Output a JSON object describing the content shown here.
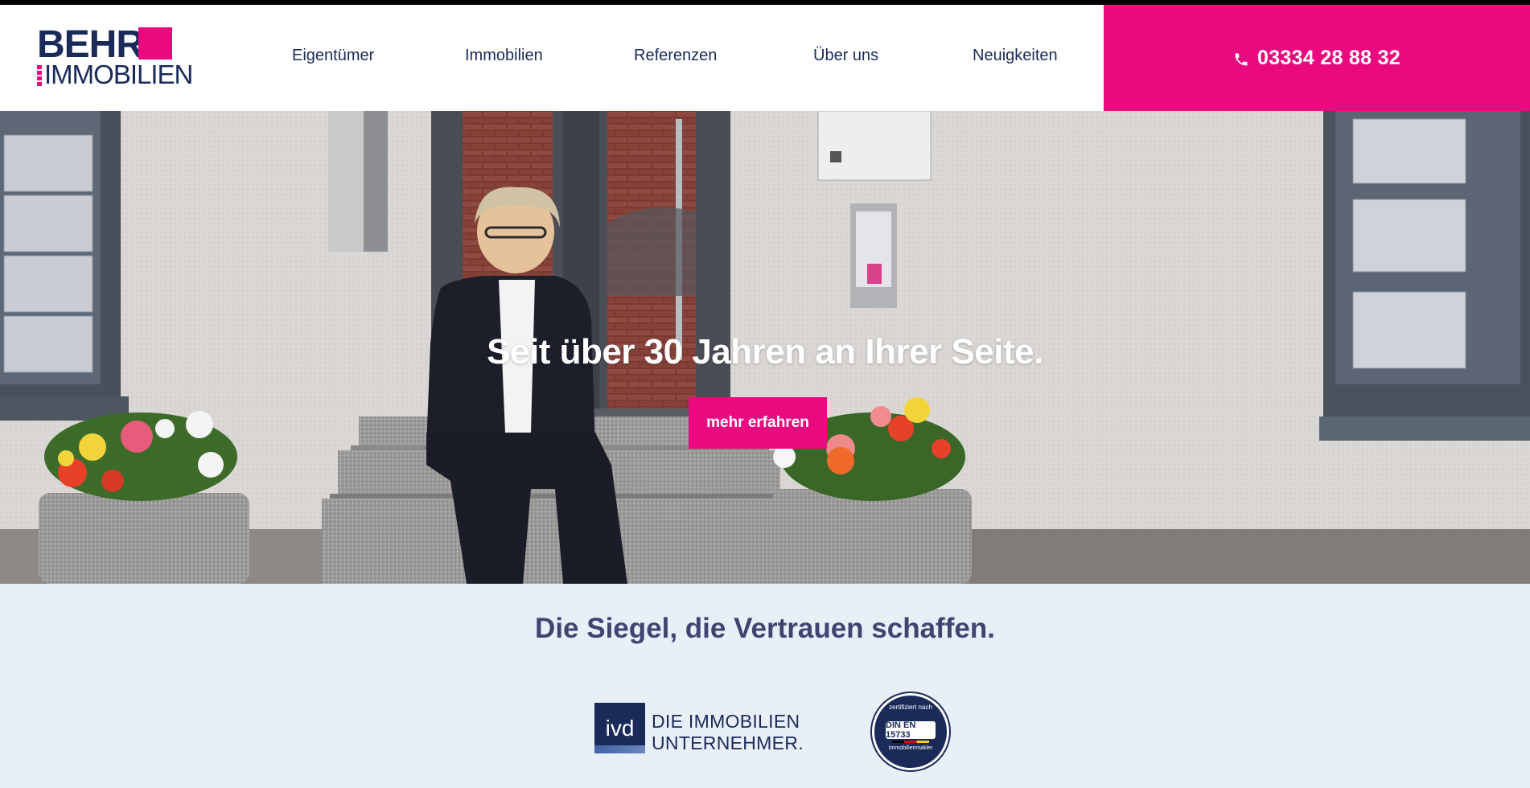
{
  "header": {
    "logo_top": "BEHR",
    "logo_bottom": "IMMOBILIEN",
    "nav": [
      {
        "label": "Eigentümer"
      },
      {
        "label": "Immobilien"
      },
      {
        "label": "Referenzen"
      },
      {
        "label": "Über uns"
      },
      {
        "label": "Neuigkeiten"
      }
    ],
    "phone": "03334 28 88 32"
  },
  "hero": {
    "title": "Seit über 30 Jahren an Ihrer Seite.",
    "button_label": "mehr erfahren"
  },
  "seals": {
    "title": "Die Siegel, die Vertrauen schaffen.",
    "ivd_mark": "ivd",
    "ivd_line1": "DIE IMMOBILIEN",
    "ivd_line2": "UNTERNEHMER.",
    "din_top": "zertifiziert nach",
    "din_center": "DIN EN 15733",
    "din_bottom": "Immobilienmakler"
  },
  "colors": {
    "brand_pink": "#ea0a80",
    "brand_navy": "#1a2a59",
    "seal_bg": "#e9eff7"
  }
}
